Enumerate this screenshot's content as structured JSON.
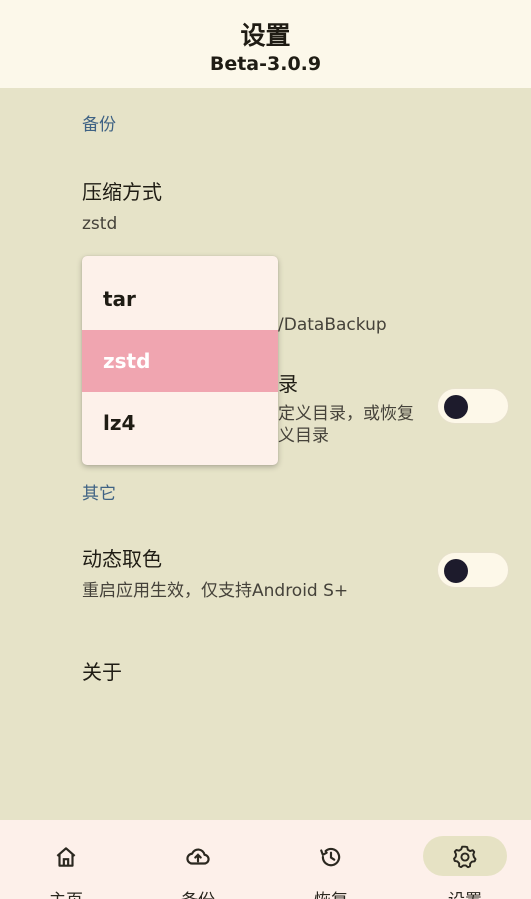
{
  "header": {
    "title": "设置",
    "subtitle": "Beta-3.0.9"
  },
  "settings": {
    "backup_section": "备份",
    "compression": {
      "label": "压缩方式",
      "value": "zstd"
    },
    "backup_dir_partial": "/DataBackup",
    "custom_dir": {
      "label_partial": "录",
      "desc_line1_partial": "定义目录，或恢复",
      "desc_line2_partial": "义目录",
      "toggle_on": false
    },
    "other_section": "其它",
    "dynamic_color": {
      "label": "动态取色",
      "desc": "重启应用生效，仅支持Android S+",
      "toggle_on": false
    },
    "about": {
      "label": "关于"
    }
  },
  "dropdown": {
    "options": [
      "tar",
      "zstd",
      "lz4"
    ],
    "selected": "zstd"
  },
  "navbar": {
    "items": [
      {
        "label": "主页",
        "icon": "home-icon"
      },
      {
        "label": "备份",
        "icon": "cloud-upload-icon"
      },
      {
        "label": "恢复",
        "icon": "history-icon"
      },
      {
        "label": "设置",
        "icon": "gear-icon"
      }
    ],
    "active": "设置"
  },
  "colors": {
    "background": "#e6e3c8",
    "header_bg": "#fcf8ea",
    "section_header": "#3f6284",
    "selected_option": "#f0a5b0",
    "active_nav_pill": "#e6e2c4"
  }
}
